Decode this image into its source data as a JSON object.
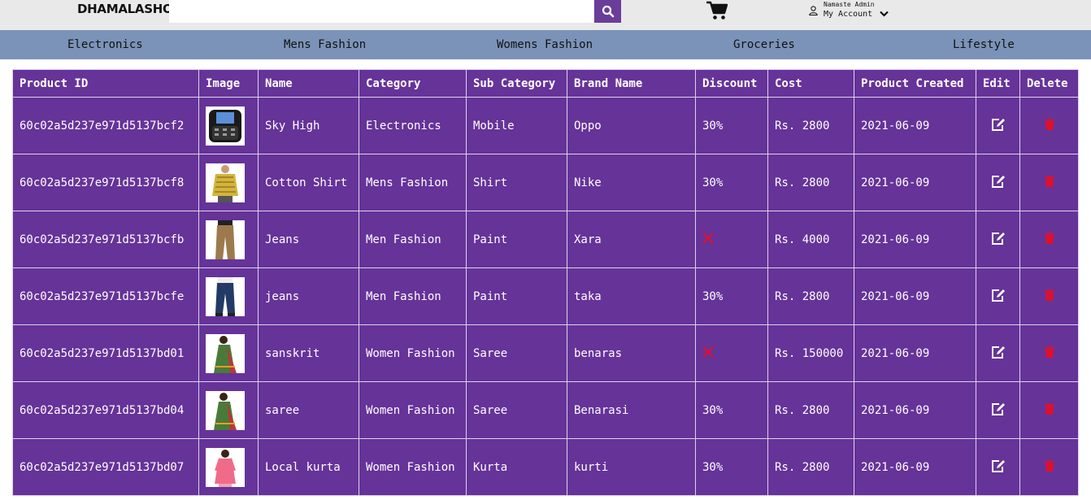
{
  "header": {
    "logo": "DHAMALASHOP",
    "search": {
      "value": "",
      "placeholder": ""
    },
    "account": {
      "greeting": "Namaste Admin",
      "label": "My Account"
    }
  },
  "nav": {
    "items": [
      "Electronics",
      "Mens Fashion",
      "Womens Fashion",
      "Groceries",
      "Lifestyle"
    ]
  },
  "table": {
    "columns": [
      "Product ID",
      "Image",
      "Name",
      "Category",
      "Sub Category",
      "Brand Name",
      "Discount",
      "Cost",
      "Product Created",
      "Edit",
      "Delete"
    ],
    "rows": [
      {
        "id": "60c02a5d237e971d5137bcf2",
        "image": "phone-thumbnail",
        "name": "Sky High",
        "category": "Electronics",
        "sub_category": "Mobile",
        "brand": "Oppo",
        "discount": "30%",
        "cost": "Rs. 2800",
        "created": "2021-06-09"
      },
      {
        "id": "60c02a5d237e971d5137bcf8",
        "image": "shirt-thumbnail",
        "name": "Cotton Shirt",
        "category": "Mens Fashion",
        "sub_category": "Shirt",
        "brand": "Nike",
        "discount": "30%",
        "cost": "Rs. 2800",
        "created": "2021-06-09"
      },
      {
        "id": "60c02a5d237e971d5137bcfb",
        "image": "pants-thumbnail",
        "name": "Jeans",
        "category": "Men Fashion",
        "sub_category": "Paint",
        "brand": "Xara",
        "discount": "",
        "cost": "Rs. 4000",
        "created": "2021-06-09"
      },
      {
        "id": "60c02a5d237e971d5137bcfe",
        "image": "jeans-thumbnail",
        "name": "jeans",
        "category": "Men Fashion",
        "sub_category": "Paint",
        "brand": "taka",
        "discount": "30%",
        "cost": "Rs. 2800",
        "created": "2021-06-09"
      },
      {
        "id": "60c02a5d237e971d5137bd01",
        "image": "saree-thumbnail",
        "name": "sanskrit",
        "category": "Women Fashion",
        "sub_category": "Saree",
        "brand": "benaras",
        "discount": "",
        "cost": "Rs. 150000",
        "created": "2021-06-09"
      },
      {
        "id": "60c02a5d237e971d5137bd04",
        "image": "saree-thumbnail",
        "name": "saree",
        "category": "Women Fashion",
        "sub_category": "Saree",
        "brand": "Benarasi",
        "discount": "30%",
        "cost": "Rs. 2800",
        "created": "2021-06-09"
      },
      {
        "id": "60c02a5d237e971d5137bd07",
        "image": "kurta-thumbnail",
        "name": "Local kurta",
        "category": "Women Fashion",
        "sub_category": "Kurta",
        "brand": "kurti",
        "discount": "30%",
        "cost": "Rs. 2800",
        "created": "2021-06-09"
      }
    ]
  },
  "colors": {
    "topbar": "#e9e9e9",
    "nav": "#7b93b8",
    "table": "#663399",
    "accent": "#6a3d9a",
    "delete": "#e0102a"
  }
}
